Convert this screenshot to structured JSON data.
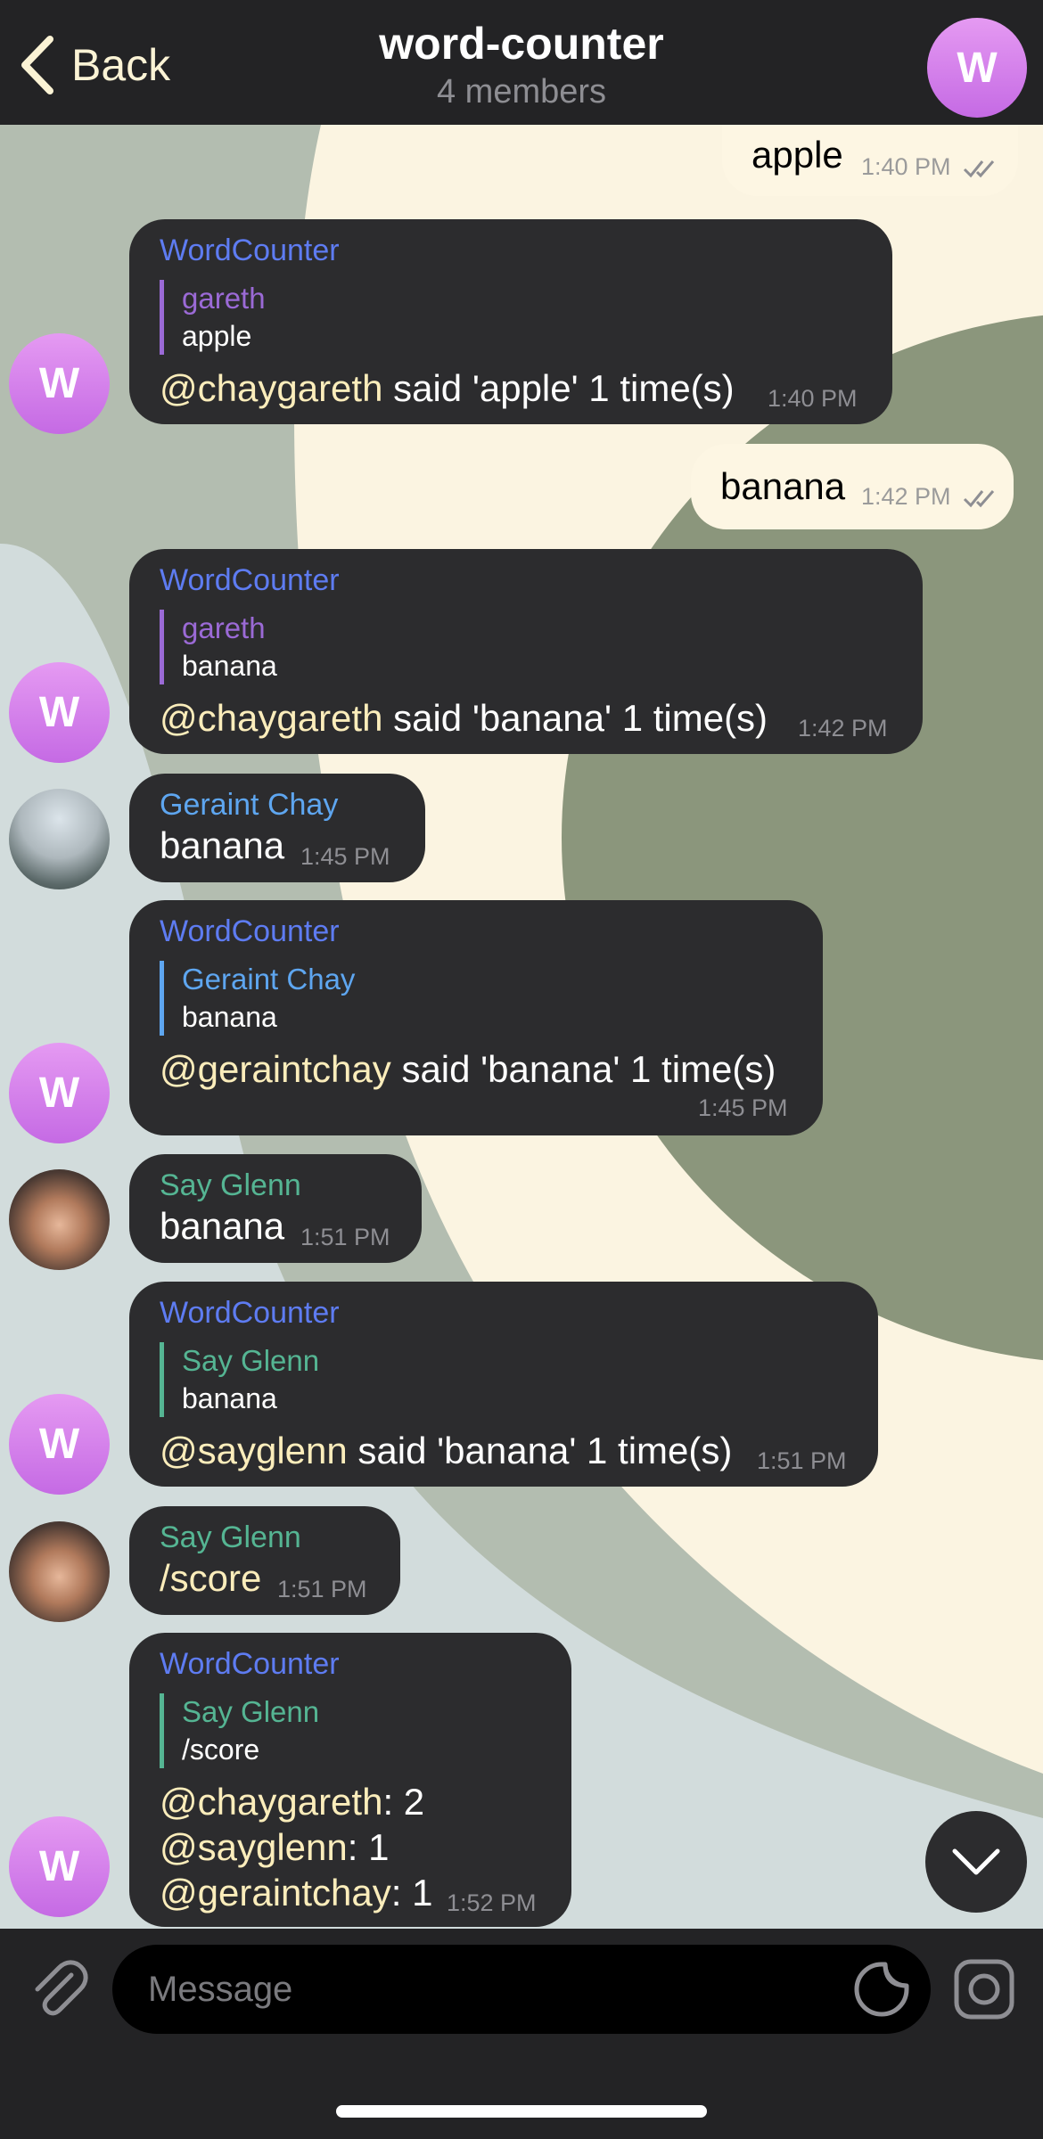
{
  "header": {
    "back_label": "Back",
    "title": "word-counter",
    "subtitle": "4 members",
    "avatar_letter": "W"
  },
  "colors": {
    "accent_name": "#5e7cf2",
    "gareth_color": "#9b6ad6",
    "geraint_color": "#5ea6f0",
    "glenn_color": "#55b593",
    "mention": "#fbedbb"
  },
  "messages": [
    {
      "type": "outgoing",
      "text": "apple",
      "time": "1:40 PM",
      "status": "read"
    },
    {
      "type": "incoming",
      "sender": "WordCounter",
      "avatar": "W",
      "reply": {
        "name": "gareth",
        "text": "apple"
      },
      "mention": "@chaygareth",
      "text": " said 'apple' 1 time(s)",
      "time": "1:40 PM"
    },
    {
      "type": "outgoing",
      "text": "banana",
      "time": "1:42 PM",
      "status": "read"
    },
    {
      "type": "incoming",
      "sender": "WordCounter",
      "avatar": "W",
      "reply": {
        "name": "gareth",
        "text": "banana"
      },
      "mention": "@chaygareth",
      "text": " said 'banana' 1 time(s)",
      "time": "1:42 PM"
    },
    {
      "type": "incoming",
      "sender": "Geraint Chay",
      "text": "banana",
      "time": "1:45 PM"
    },
    {
      "type": "incoming",
      "sender": "WordCounter",
      "avatar": "W",
      "reply": {
        "name": "Geraint Chay",
        "text": "banana"
      },
      "mention": "@geraintchay",
      "text": " said 'banana' 1 time(s)",
      "time": "1:45 PM"
    },
    {
      "type": "incoming",
      "sender": "Say Glenn",
      "text": "banana",
      "time": "1:51 PM"
    },
    {
      "type": "incoming",
      "sender": "WordCounter",
      "avatar": "W",
      "reply": {
        "name": "Say Glenn",
        "text": "banana"
      },
      "mention": "@sayglenn",
      "text": " said 'banana' 1 time(s)",
      "time": "1:51 PM"
    },
    {
      "type": "incoming",
      "sender": "Say Glenn",
      "text": "/score",
      "time": "1:51 PM"
    },
    {
      "type": "incoming",
      "sender": "WordCounter",
      "avatar": "W",
      "reply": {
        "name": "Say Glenn",
        "text": "/score"
      },
      "score_lines": [
        {
          "mention": "@chaygareth",
          "value": ": 2"
        },
        {
          "mention": "@sayglenn",
          "value": ": 1"
        },
        {
          "mention": "@geraintchay",
          "value": ": 1"
        }
      ],
      "time": "1:52 PM"
    }
  ],
  "input": {
    "placeholder": "Message"
  },
  "icons": [
    "back-chevron-icon",
    "attach-icon",
    "sticker-icon",
    "camera-icon",
    "chevron-down-icon",
    "double-check-icon"
  ]
}
